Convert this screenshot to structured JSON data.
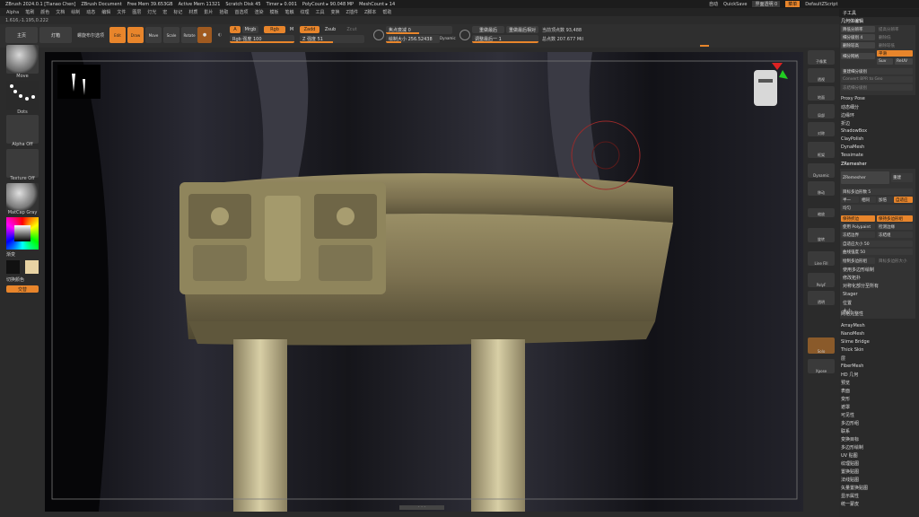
{
  "titlebar": {
    "items": [
      "ZBrush 2024.0.1 [Tianao Chen]",
      "ZBrush Document",
      "Free Mem 39.653GB",
      "Active Mem 11321",
      "Scratch Disk 45",
      "Timer ▸ 0.001",
      "PolyCount ▸ 90.048 MP",
      "MeshCount ▸ 14"
    ],
    "right": [
      "自动",
      "QuickSave",
      "界面透明 0",
      "菜单",
      "DefaultZScript"
    ]
  },
  "menubar": {
    "items": [
      "Alpha",
      "笔刷",
      "颜色",
      "文档",
      "绘制",
      "动态",
      "编辑",
      "文件",
      "图层",
      "灯光",
      "宏",
      "标记",
      "材质",
      "影片",
      "拾取",
      "首选项",
      "渲染",
      "模板",
      "笔触",
      "纹理",
      "工具",
      "变换",
      "Z插件",
      "Z脚本",
      "帮助"
    ]
  },
  "coords": "1.616,-1.195,0.222",
  "topshelf": {
    "projection": "主页",
    "lightbox": "灯箱",
    "lightbox2": "螺旋布尔选项",
    "tool_buttons": [
      "Edit",
      "Draw",
      "Move",
      "Scale",
      "Rotate"
    ],
    "a": "A",
    "mrgb": "Mrgb",
    "rgb": "Rgb",
    "m": "M",
    "zadd": "Zadd",
    "zsub": "Zsub",
    "zcut": "Zcut",
    "rgb_intensity": "Rgb 强度 100",
    "z_intensity": "Z 强度 51",
    "focal_shift": "焦点衰减 0",
    "draw_size": "绘制大小 256.52438",
    "dynamic": "Dynamic",
    "adjust_last": "重做最后",
    "adjust_last_rel": "重做最后相对",
    "adjust_last_val": "调整最后一 1",
    "active_points": "当前顶点数 93,488",
    "total_points": "总点数 207.677 Mil"
  },
  "leftshelf": {
    "brush": "Move",
    "stroke": "Dots",
    "alpha": "Alpha Off",
    "texture": "Texture Off",
    "material": "MatCap Gray",
    "gradient": "渐变",
    "switch_color": "切换颜色",
    "alternate": "交替"
  },
  "rightshelf": {
    "buttons": [
      "子像素",
      "透视",
      "地面",
      "局部",
      "对称",
      "框架",
      "Dynamic",
      "移动",
      "缩放",
      "旋转",
      "Line Fill",
      "PolyF",
      "透明",
      "Solo",
      "Xpose"
    ]
  },
  "panel": {
    "title": "子工具",
    "section": "几何体编辑",
    "subdiv_rows": [
      [
        "降低分辨率",
        "提高分辨率"
      ],
      [
        "细分级别 4",
        "删除低"
      ],
      [
        "删除较高",
        "删除较低"
      ]
    ],
    "divide": "细分网格",
    "smt": "平滑",
    "suv": "Suv",
    "relv": "ReUV",
    "reconstruct": "重建细分级别",
    "convert": "Convert BPR to Geo",
    "freeze": "冻结细分级别",
    "items_top": [
      "Proxy Pose",
      "动态细分",
      "边缘环",
      "折边",
      "ShadowBox",
      "ClayPolish",
      "DynaMesh",
      "Tessimate",
      "ZRemesher"
    ],
    "zremesher_btn": "ZRemesher",
    "legacy": "重建",
    "target_count": "目标多边形数 5",
    "half": "半一",
    "same": "相同",
    "double": "加倍",
    "adaptive": "自适应",
    "adapt_size": "自适应大小 50",
    "curves_strength": "曲线强度 50",
    "keep_creases": "保持折边",
    "keep_groups": "保持多边形组",
    "detect_edges": "检测边缘",
    "polypaint": "使用 Polypaint",
    "freeze_border": "冻结边界",
    "freeze_groups": "冻结组",
    "use_polypaint": "绘制多边形组",
    "target_size": "目标多边形大小",
    "uniform": "均匀",
    "items_mid": [
      "使用多边形绘制",
      "修改拓扑",
      "对称化部分至所有",
      "Stager",
      "位置",
      "大小",
      "网格完整性"
    ],
    "items_bottom": [
      "ArrayMesh",
      "NanoMesh",
      "Slime Bridge",
      "Thick Skin",
      "层",
      "FiberMesh",
      "HD 几何",
      "预览",
      "表面",
      "变形",
      "遮罩",
      "可见性",
      "多边形组",
      "联系",
      "变换目标",
      "多边形绘制",
      "UV 贴图",
      "纹理贴图",
      "置换贴图",
      "法线贴图",
      "矢量置换贴图",
      "显示属性",
      "统一蒙皮"
    ]
  },
  "viewport_nav": "· · ·"
}
